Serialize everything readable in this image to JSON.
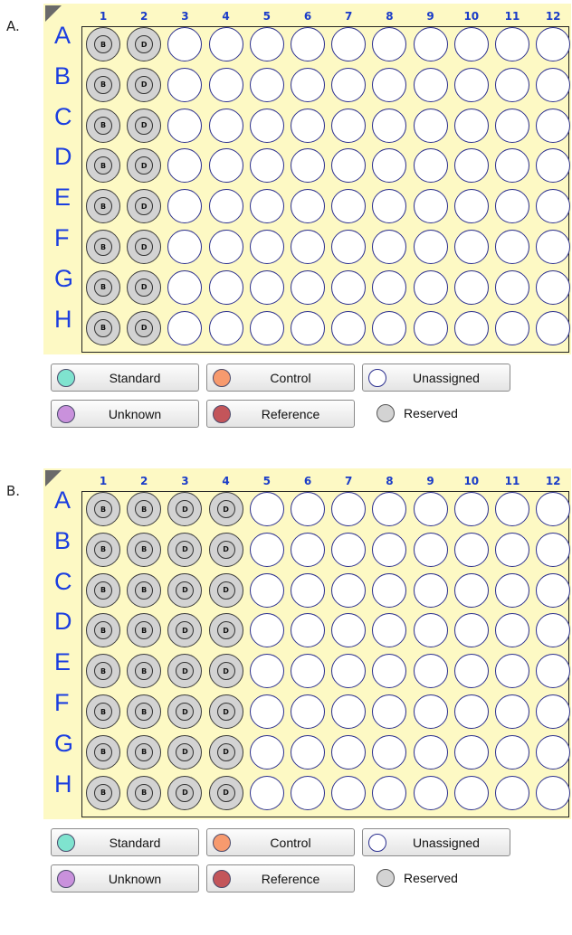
{
  "panels": [
    {
      "id": "a",
      "label": "A.",
      "columns": [
        "1",
        "2",
        "3",
        "4",
        "5",
        "6",
        "7",
        "8",
        "9",
        "10",
        "11",
        "12"
      ],
      "rows": [
        "A",
        "B",
        "C",
        "D",
        "E",
        "F",
        "G",
        "H"
      ],
      "reserved_columns": {
        "1": "B",
        "2": "D"
      }
    },
    {
      "id": "b",
      "label": "B.",
      "columns": [
        "1",
        "2",
        "3",
        "4",
        "5",
        "6",
        "7",
        "8",
        "9",
        "10",
        "11",
        "12"
      ],
      "rows": [
        "A",
        "B",
        "C",
        "D",
        "E",
        "F",
        "G",
        "H"
      ],
      "reserved_columns": {
        "1": "B",
        "2": "B",
        "3": "D",
        "4": "D"
      }
    }
  ],
  "legend": {
    "standard": {
      "label": "Standard",
      "color": "#7fe3cf"
    },
    "control": {
      "label": "Control",
      "color": "#f79a6e"
    },
    "unassigned": {
      "label": "Unassigned",
      "color": "#ffffff"
    },
    "unknown": {
      "label": "Unknown",
      "color": "#c991dc"
    },
    "reference": {
      "label": "Reference",
      "color": "#c3555a"
    },
    "reserved": {
      "label": "Reserved",
      "color": "#d3d3d3"
    }
  }
}
